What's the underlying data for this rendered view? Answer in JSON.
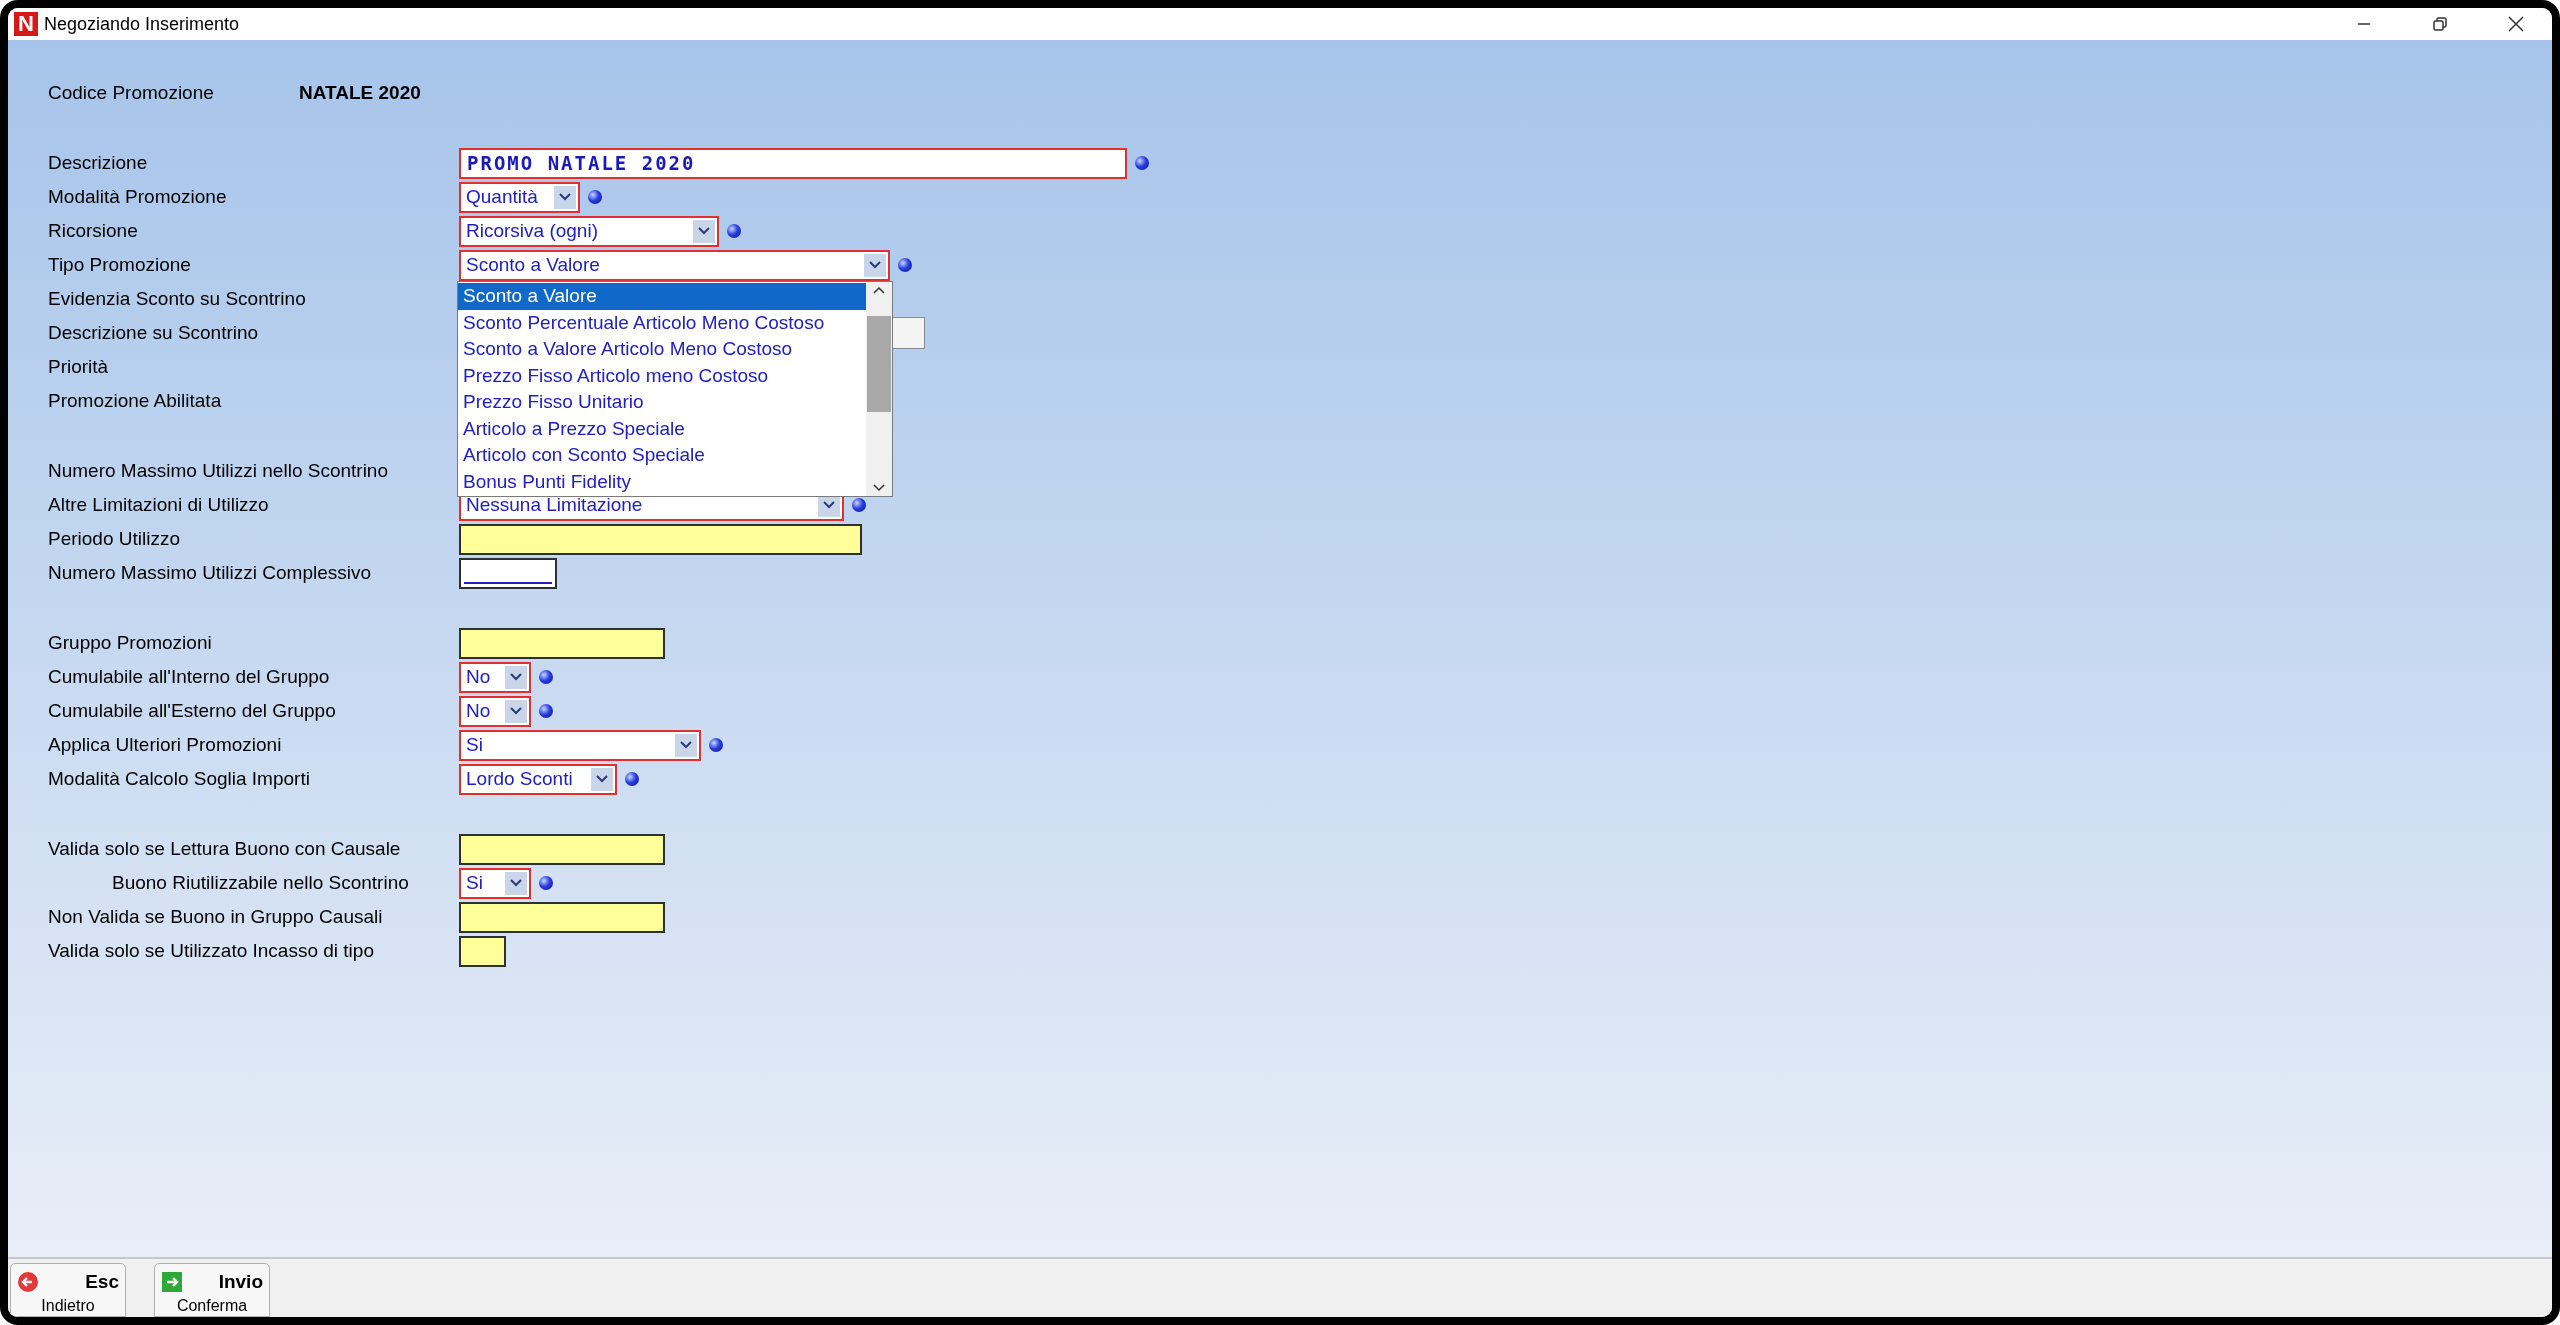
{
  "window": {
    "app_icon": "N",
    "title": "Negoziando  Inserimento"
  },
  "header": {
    "label": "Codice Promozione",
    "value": "NATALE 2020"
  },
  "sections": [
    {
      "rows": [
        {
          "label": "Descrizione",
          "kind": "text",
          "value": "PROMO NATALE 2020"
        },
        {
          "label": "Modalità Promozione",
          "kind": "select",
          "value": "Quantità"
        },
        {
          "label": "Ricorsione",
          "kind": "select",
          "value": "Ricorsiva (ogni)"
        },
        {
          "label": "Tipo Promozione",
          "kind": "select",
          "value": "Sconto a Valore",
          "expanded": true,
          "options": [
            {
              "label": "Sconto a Valore",
              "selected": true
            },
            {
              "label": "Sconto Percentuale Articolo Meno Costoso",
              "selected": false
            },
            {
              "label": "Sconto a Valore Articolo Meno Costoso",
              "selected": false
            },
            {
              "label": "Prezzo Fisso Articolo meno Costoso",
              "selected": false
            },
            {
              "label": "Prezzo Fisso Unitario",
              "selected": false
            },
            {
              "label": "Articolo a Prezzo Speciale",
              "selected": false
            },
            {
              "label": "Articolo con Sconto Speciale",
              "selected": false
            },
            {
              "label": "Bonus Punti Fidelity",
              "selected": false
            }
          ]
        },
        {
          "label": "Evidenzia Sconto su Scontrino",
          "kind": "covered"
        },
        {
          "label": "Descrizione su Scontrino",
          "kind": "covered",
          "button": true
        },
        {
          "label": "Priorità",
          "kind": "covered"
        },
        {
          "label": "Promozione Abilitata",
          "kind": "covered"
        }
      ]
    },
    {
      "rows": [
        {
          "label": "Numero Massimo Utilizzi nello Scontrino",
          "kind": "covered"
        },
        {
          "label": "Altre Limitazioni di Utilizzo",
          "kind": "select",
          "value": "Nessuna Limitazione"
        },
        {
          "label": "Periodo Utilizzo",
          "kind": "input"
        },
        {
          "label": "Numero Massimo Utilizzi Complessivo",
          "kind": "number"
        }
      ]
    },
    {
      "rows": [
        {
          "label": "Gruppo Promozioni",
          "kind": "input"
        },
        {
          "label": "Cumulabile all'Interno del Gruppo",
          "kind": "select",
          "value": "No"
        },
        {
          "label": "Cumulabile all'Esterno del Gruppo",
          "kind": "select",
          "value": "No"
        },
        {
          "label": "Applica Ulteriori Promozioni",
          "kind": "select",
          "value": "Si"
        },
        {
          "label": "Modalità Calcolo Soglia Importi",
          "kind": "select",
          "value": "Lordo Sconti"
        }
      ]
    },
    {
      "rows": [
        {
          "label": "Valida solo se Lettura Buono con Causale",
          "kind": "input",
          "children": [
            {
              "label": "Buono Riutilizzabile nello Scontrino",
              "kind": "select",
              "value": "Si"
            }
          ]
        },
        {
          "label": "Non Valida se Buono in Gruppo Causali",
          "kind": "input"
        },
        {
          "label": "Valida solo se Utilizzato Incasso di tipo",
          "kind": "input"
        }
      ]
    }
  ],
  "buttons": [
    {
      "kind": "back",
      "key": "Esc",
      "label": "Indietro"
    },
    {
      "kind": "confirm",
      "key": "Invio",
      "label": "Conferma"
    }
  ]
}
